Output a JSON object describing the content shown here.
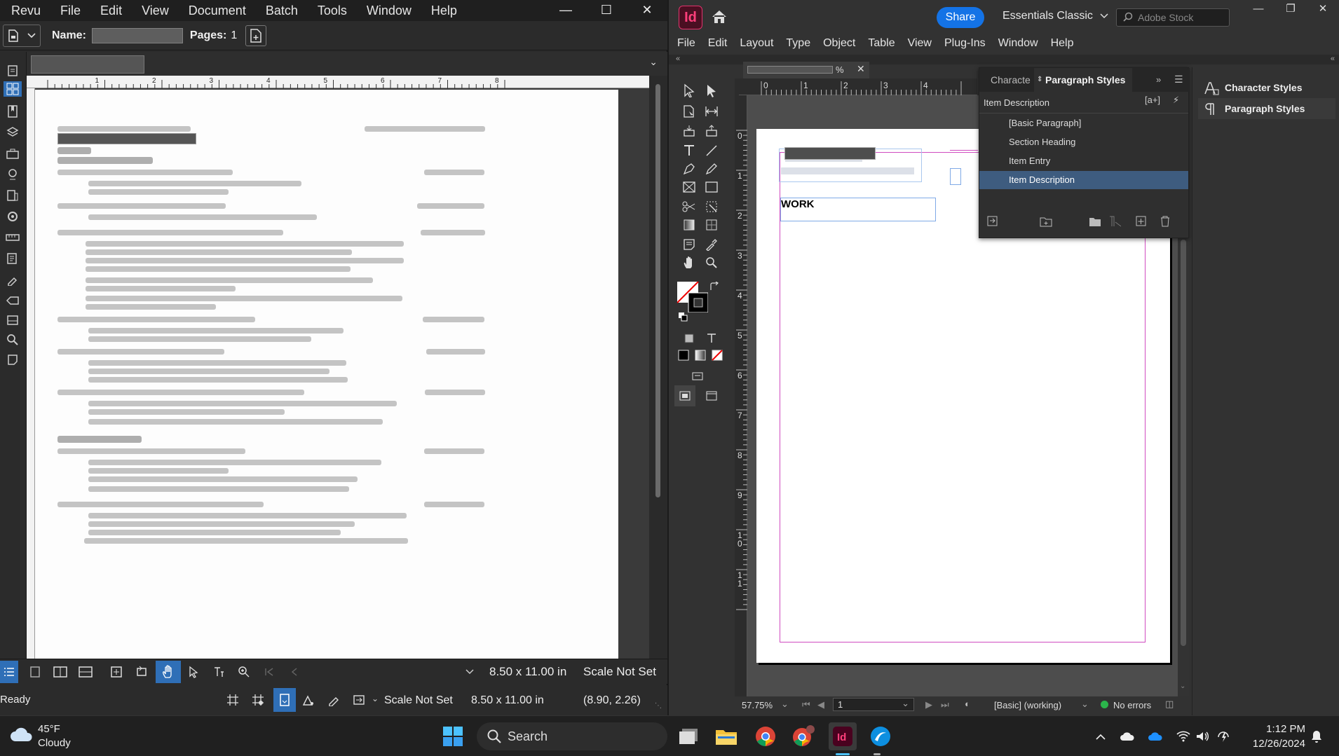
{
  "revu": {
    "menu": [
      "Revu",
      "File",
      "Edit",
      "View",
      "Document",
      "Batch",
      "Tools",
      "Window",
      "Help"
    ],
    "toolbar": {
      "name_label": "Name:",
      "pages_label": "Pages:",
      "pages_value": "1"
    },
    "bottom": {
      "page_size": "8.50 x 11.00 in",
      "scale": "Scale Not Set",
      "status": "Ready",
      "scale2": "Scale Not Set",
      "page_size2": "8.50 x 11.00 in",
      "coords": "(8.90, 2.26)"
    },
    "ruler_labels": [
      "1",
      "2",
      "3",
      "4",
      "5",
      "6",
      "7",
      "8"
    ]
  },
  "indesign": {
    "logo": "Id",
    "share_label": "Share",
    "workspace": "Essentials Classic",
    "stock_placeholder": "Adobe Stock",
    "menu": [
      "File",
      "Edit",
      "Layout",
      "Type",
      "Object",
      "Table",
      "View",
      "Plug-Ins",
      "Window",
      "Help"
    ],
    "doc_tab": {
      "zoom_suffix": "%",
      "close": "✕"
    },
    "page_text": "WORK",
    "ruler_h": [
      "0",
      "1",
      "2",
      "3",
      "4"
    ],
    "ruler_v": [
      "0",
      "1",
      "2",
      "3",
      "4",
      "5",
      "6",
      "7",
      "8",
      "9",
      "10",
      "11"
    ],
    "status": {
      "zoom": "57.75%",
      "page": "1",
      "style": "[Basic] (working)",
      "errors": "No errors"
    },
    "panel": {
      "tab_char": "Characte",
      "tab_para": "Paragraph Styles",
      "current": "Item Description",
      "styles": [
        "[Basic Paragraph]",
        "Section Heading",
        "Item Entry",
        "Item Description"
      ],
      "selected_index": 3
    },
    "side_panels": [
      "Character Styles",
      "Paragraph Styles"
    ]
  },
  "taskbar": {
    "weather_temp": "45°F",
    "weather_cond": "Cloudy",
    "search_label": "Search",
    "time": "1:12 PM",
    "date": "12/26/2024"
  },
  "colors": {
    "indesign_accent": "#ff3f7b",
    "share_blue": "#1473e6",
    "selected_row": "#3e5c7f",
    "revu_active_tool": "#2f6fb7"
  }
}
